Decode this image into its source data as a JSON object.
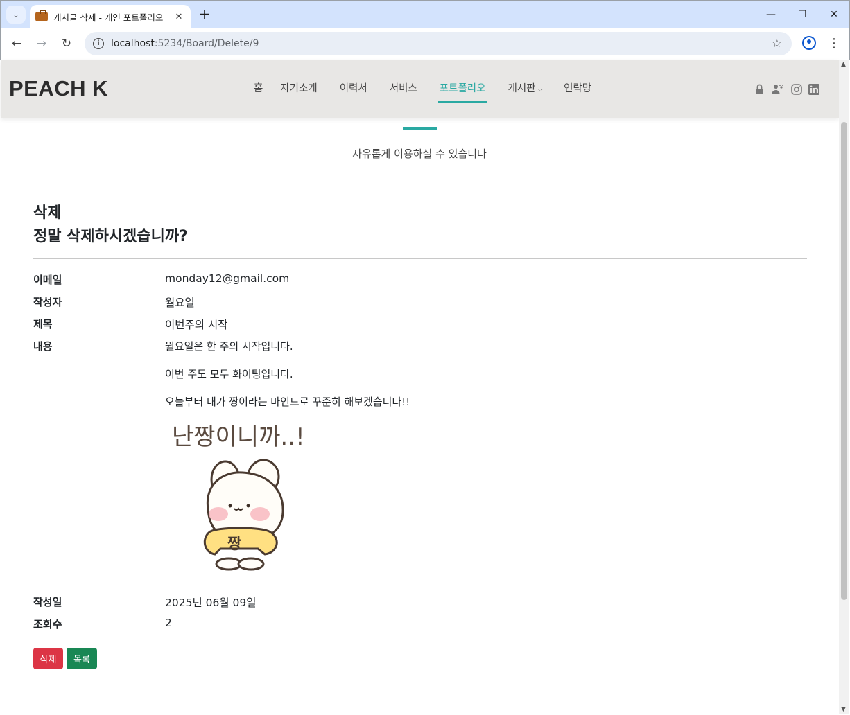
{
  "browser": {
    "tab_title": "게시글 삭제 - 개인 포트폴리오",
    "url_host": "localhost",
    "url_path": ":5234/Board/Delete/9"
  },
  "site": {
    "logo": "PEACH K",
    "nav": [
      {
        "label": "홈"
      },
      {
        "label": "자기소개"
      },
      {
        "label": "이력서"
      },
      {
        "label": "서비스"
      },
      {
        "label": "포트폴리오",
        "active": true
      },
      {
        "label": "게시판",
        "dropdown": true
      },
      {
        "label": "연락망"
      }
    ],
    "header_icons": [
      "lock-icon",
      "user-paw-icon",
      "instagram-icon",
      "linkedin-icon"
    ],
    "accent_color": "#2aa9a2"
  },
  "section": {
    "subtitle": "자유롭게 이용하실 수 있습니다"
  },
  "page": {
    "title": "삭제",
    "confirm": "정말 삭제하시겠습니까?"
  },
  "details": {
    "email_label": "이메일",
    "email": "monday12@gmail.com",
    "author_label": "작성자",
    "author": "월요일",
    "subject_label": "제목",
    "subject": "이번주의 시작",
    "content_label": "내용",
    "content": [
      "월요일은 한 주의 시작입니다.",
      "이번 주도 모두 화이팅입니다.",
      "오늘부터 내가 짱이라는 마인드로 꾸준히 해보겠습니다!!"
    ],
    "sticker_caption": "난짱이니까..!",
    "sticker_shirt": "짱",
    "date_label": "작성일",
    "date": "2025년 06월 09일",
    "views_label": "조회수",
    "views": "2"
  },
  "buttons": {
    "delete": "삭제",
    "list": "목록"
  }
}
